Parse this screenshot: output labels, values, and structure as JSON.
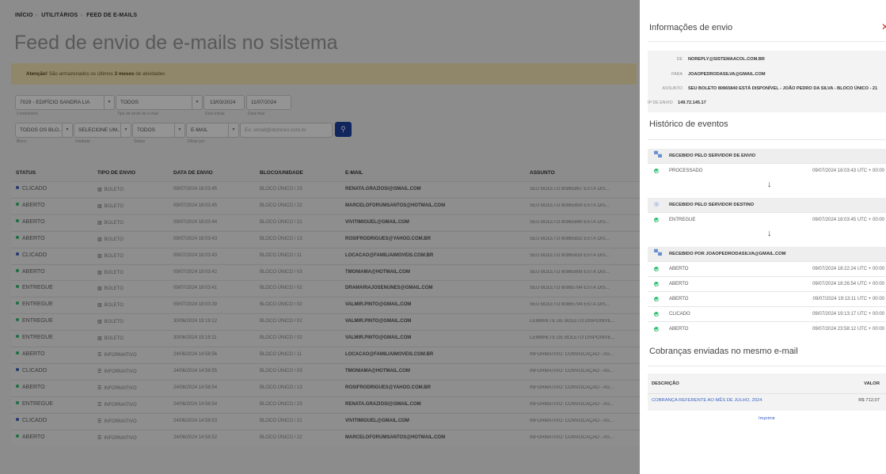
{
  "breadcrumb": [
    "INÍCIO",
    "UTILITÁRIOS",
    "FEED DE E-MAILS"
  ],
  "page_title": "Feed de envio de e-mails no sistema",
  "alert": {
    "prefix": "Atenção!",
    "text": " São armazenados os últimos ",
    "bold": "3 meses",
    "suffix": " de atividades"
  },
  "filters": {
    "condominio": {
      "value": "7029 - EDIFÍCIO SANDRA LIA",
      "label": "Condomínio"
    },
    "tipo": {
      "value": "TODOS",
      "label": "Tipo de envio de e-mail"
    },
    "data_inicial": {
      "value": "13/03/2024",
      "label": "Data inicial"
    },
    "data_final": {
      "value": "11/07/2024",
      "label": "Data final"
    },
    "bloco": {
      "value": "TODOS OS BLO...",
      "label": "Bloco"
    },
    "unidade": {
      "value": "SELECIONE UM...",
      "label": "Unidade"
    },
    "status": {
      "value": "TODOS",
      "label": "Status"
    },
    "filtrar_por": {
      "value": "E-MAIL",
      "label": "Filtrar por"
    },
    "search_placeholder": "Ex: email@dominio.com.br"
  },
  "table": {
    "headers": {
      "status": "STATUS",
      "tipo": "TIPO DE ENVIO",
      "data": "DATA DE ENVIO",
      "bloco": "BLOCO/UNIDADE",
      "email": "E-MAIL",
      "assunto": "ASSUNTO"
    },
    "rows": [
      {
        "status": "CLICADO",
        "color": "#3b63c4",
        "tipo": "BOLETO",
        "data": "09/07/2024 18:03:45",
        "bloco": "BLOCO ÚNICO / 23",
        "email": "RENATA.GRAZIOSI@GMAIL.COM",
        "assunto": "SEU BOLETO 80865867 ESTÁ DIS..."
      },
      {
        "status": "ABERTO",
        "color": "#2fbf71",
        "tipo": "BOLETO",
        "data": "09/07/2024 18:03:45",
        "bloco": "BLOCO ÚNICO / 22",
        "email": "MARCELOFORUMSANTOS@HOTMAIL.COM",
        "assunto": "SEU BOLETO 80865859 ESTÁ DIS..."
      },
      {
        "status": "ABERTO",
        "color": "#2fbf71",
        "tipo": "BOLETO",
        "data": "09/07/2024 18:03:44",
        "bloco": "BLOCO ÚNICO / 21",
        "email": "VIVITIMIGUEL@GMAIL.COM",
        "assunto": "SEU BOLETO 80865840 ESTÁ DIS..."
      },
      {
        "status": "ABERTO",
        "color": "#2fbf71",
        "tipo": "BOLETO",
        "data": "09/07/2024 18:03:43",
        "bloco": "BLOCO ÚNICO / 13",
        "email": "ROSIFRODRIGUES@YAHOO.COM.BR",
        "assunto": "SEU BOLETO 80865832 ESTÁ DIS..."
      },
      {
        "status": "CLICADO",
        "color": "#3b63c4",
        "tipo": "BOLETO",
        "data": "09/07/2024 18:03:43",
        "bloco": "BLOCO ÚNICO / 11",
        "email": "LOCACAO@FAMILIAIMOVEIS.COM.BR",
        "assunto": "SEU BOLETO 80865816 ESTÁ DIS..."
      },
      {
        "status": "ABERTO",
        "color": "#2fbf71",
        "tipo": "BOLETO",
        "data": "09/07/2024 18:03:42",
        "bloco": "BLOCO ÚNICO / 03",
        "email": "TMONIAMA@HOTMAIL.COM",
        "assunto": "SEU BOLETO 80865808 ESTÁ DIS..."
      },
      {
        "status": "ENTREGUE",
        "color": "#2fbf71",
        "tipo": "BOLETO",
        "data": "09/07/2024 18:03:41",
        "bloco": "BLOCO ÚNICO / 02",
        "email": "DRAMARIAJOSENUNES@GMAIL.COM",
        "assunto": "SEU BOLETO 80865794 ESTÁ DIS..."
      },
      {
        "status": "ENTREGUE",
        "color": "#2fbf71",
        "tipo": "BOLETO",
        "data": "09/07/2024 18:03:39",
        "bloco": "BLOCO ÚNICO / 02",
        "email": "VALMIR.PINTO@GMAIL.COM",
        "assunto": "SEU BOLETO 80865794 ESTÁ DIS..."
      },
      {
        "status": "ENTREGUE",
        "color": "#2fbf71",
        "tipo": "BOLETO",
        "data": "30/06/2024 19:19:12",
        "bloco": "BLOCO ÚNICO / 02",
        "email": "VALMIR.PINTO@GMAIL.COM",
        "assunto": "LEMBRETE DE BOLETO DISPONIVE..."
      },
      {
        "status": "ENTREGUE",
        "color": "#2fbf71",
        "tipo": "BOLETO",
        "data": "30/06/2024 19:19:11",
        "bloco": "BLOCO ÚNICO / 02",
        "email": "VALMIR.PINTO@GMAIL.COM",
        "assunto": "LEMBRETE DE BOLETO DISPONIVE..."
      },
      {
        "status": "ABERTO",
        "color": "#2fbf71",
        "tipo": "INFORMATIVO",
        "data": "24/06/2024 14:58:56",
        "bloco": "BLOCO ÚNICO / 11",
        "email": "LOCACAO@FAMILIAIMOVEIS.COM.BR",
        "assunto": "INFORMATIVO: CONVOCAÇÃO - AS..."
      },
      {
        "status": "CLICADO",
        "color": "#3b63c4",
        "tipo": "INFORMATIVO",
        "data": "24/06/2024 14:58:55",
        "bloco": "BLOCO ÚNICO / 03",
        "email": "TMONIAMA@HOTMAIL.COM",
        "assunto": "INFORMATIVO: CONVOCAÇÃO - AS..."
      },
      {
        "status": "ABERTO",
        "color": "#2fbf71",
        "tipo": "INFORMATIVO",
        "data": "24/06/2024 14:58:54",
        "bloco": "BLOCO ÚNICO / 13",
        "email": "ROSIFRODRIGUES@YAHOO.COM.BR",
        "assunto": "INFORMATIVO: CONVOCAÇÃO - AS..."
      },
      {
        "status": "ENTREGUE",
        "color": "#2fbf71",
        "tipo": "INFORMATIVO",
        "data": "24/06/2024 14:58:54",
        "bloco": "BLOCO ÚNICO / 23",
        "email": "RENATA.GRAZIOSI@GMAIL.COM",
        "assunto": "INFORMATIVO: CONVOCAÇÃO - AS..."
      },
      {
        "status": "CLICADO",
        "color": "#3b63c4",
        "tipo": "INFORMATIVO",
        "data": "24/06/2024 14:58:53",
        "bloco": "BLOCO ÚNICO / 21",
        "email": "VIVITIMIGUEL@GMAIL.COM",
        "assunto": "INFORMATIVO: CONVOCAÇÃO - AS..."
      },
      {
        "status": "ABERTO",
        "color": "#2fbf71",
        "tipo": "INFORMATIVO",
        "data": "24/06/2024 14:58:52",
        "bloco": "BLOCO ÚNICO / 22",
        "email": "MARCELOFORUMSANTOS@HOTMAIL.COM",
        "assunto": "INFORMATIVO: CONVOCAÇÃO - AS..."
      }
    ]
  },
  "panel": {
    "title": "Informações de envio",
    "close_icon": "close-icon",
    "info": {
      "de_label": "DE",
      "de": "NOREPLY@SISTEMAACOL.COM.BR",
      "para_label": "PARA",
      "para": "JOAOPEDRODASILVA@GMAIL.COM",
      "assunto_label": "ASSUNTO",
      "assunto": "SEU BOLETO 80865840 ESTÁ DISPONÍVEL - JOÃO PEDRO DA SILVA - BLOCO ÚNICO - 21",
      "ip_label": "IP DE ENVIO",
      "ip": "149.72.145.17"
    },
    "historico_title": "Histórico de eventos",
    "events": [
      {
        "head": "RECEBIDO PELO SERVIDOR DE ENVIO",
        "icon": "server-icon",
        "rows": [
          {
            "status": "PROCESSADO",
            "time": "09/07/2024 18:03:43 UTC + 00:00"
          }
        ]
      },
      {
        "head": "RECEBIDO PELO SERVIDOR DESTINO",
        "icon": "inbox-icon",
        "rows": [
          {
            "status": "ENTREGUE",
            "time": "09/07/2024 18:03:45 UTC + 00:00"
          }
        ]
      },
      {
        "head": "RECEBIDO POR JOAOPEDRODASILVA@GMAIL.COM",
        "icon": "user-icon",
        "rows": [
          {
            "status": "ABERTO",
            "time": "09/07/2024 18:22:24 UTC + 00:00"
          },
          {
            "status": "ABERTO",
            "time": "09/07/2024 18:26:54 UTC + 00:00"
          },
          {
            "status": "ABERTO",
            "time": "09/07/2024 19:13:11 UTC + 00:00"
          },
          {
            "status": "CLICADO",
            "time": "09/07/2024 19:13:17 UTC + 00:00"
          },
          {
            "status": "ABERTO",
            "time": "09/07/2024 23:58:12 UTC + 00:00"
          }
        ]
      }
    ],
    "cobrancas_title": "Cobranças enviadas no mesmo e-mail",
    "cobrancas": {
      "h_desc": "DESCRIÇÃO",
      "h_valor": "VALOR",
      "desc": "COBRANÇA REFERENTE AO MÊS DE JULHO, 2024",
      "valor": "R$ 712,07"
    },
    "print_label": "Imprimir"
  }
}
